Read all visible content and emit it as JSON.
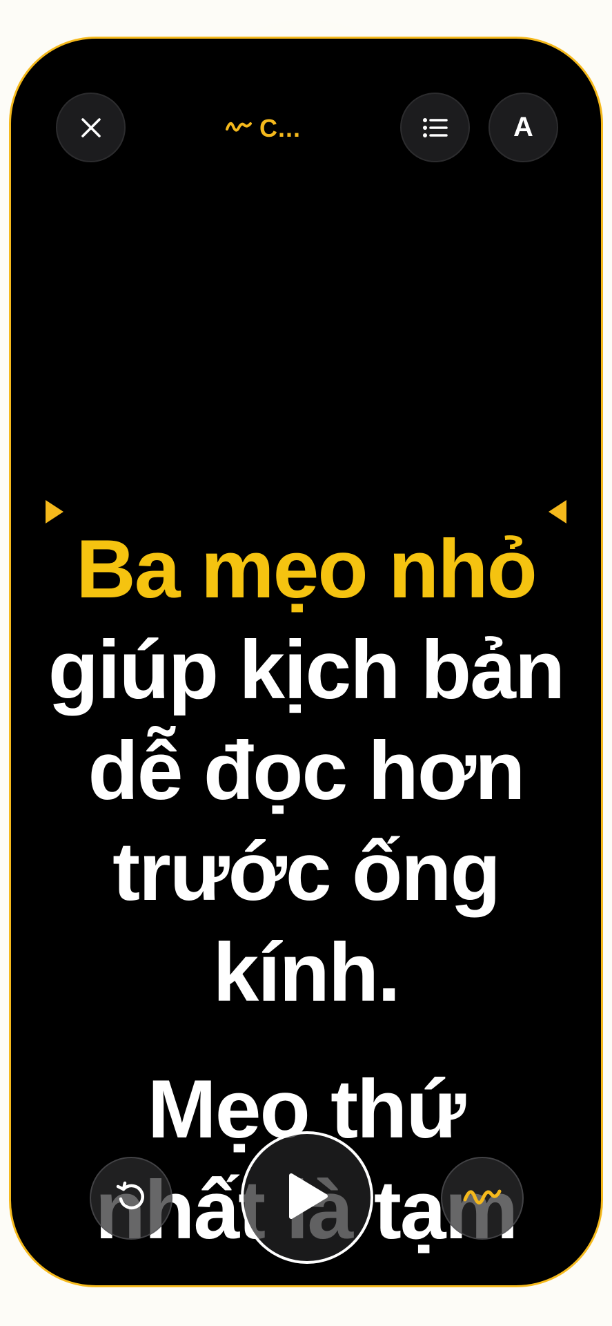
{
  "header": {
    "close_icon": "close-icon",
    "title_icon": "waveform-icon",
    "title": "C...",
    "list_icon": "list-icon",
    "font_button_label": "A"
  },
  "teleprompter": {
    "highlighted_line": "Ba mẹo nhỏ",
    "lines": [
      "giúp kịch bản",
      "dễ đọc hơn",
      "trước ống",
      "kính.",
      "Mẹo thứ",
      "nhất là tạm"
    ]
  },
  "controls": {
    "restart_icon": "restart-icon",
    "play_icon": "play-icon",
    "voice_icon": "waveform-icon"
  },
  "colors": {
    "accent": "#f5c310",
    "frame": "#f5b91c",
    "background": "#000000",
    "text": "#ffffff",
    "button_bg": "#1c1c1e"
  }
}
